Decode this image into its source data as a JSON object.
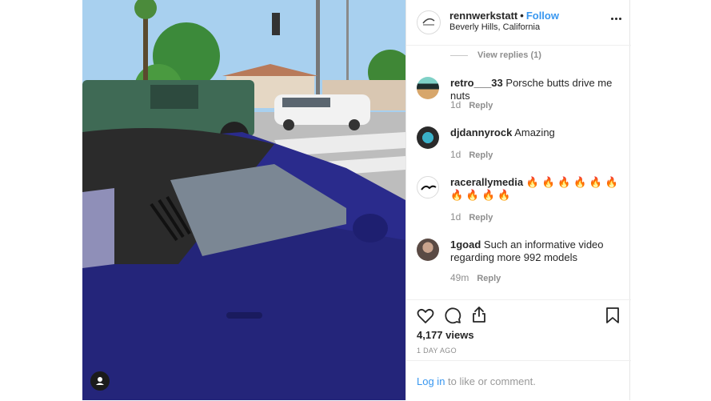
{
  "post": {
    "username": "rennwerkstatt",
    "separator": "•",
    "follow_label": "Follow",
    "location": "Beverly Hills, California"
  },
  "thread": {
    "view_replies": "View replies (1)"
  },
  "comments": [
    {
      "user": "retro___33",
      "text": "Porsche butts drive me nuts",
      "time": "1d",
      "reply": "Reply"
    },
    {
      "user": "djdannyrock",
      "text": "Amazing",
      "time": "1d",
      "reply": "Reply"
    },
    {
      "user": "racerallymedia",
      "text": "🔥 🔥 🔥 🔥 🔥 🔥 🔥 🔥 🔥 🔥",
      "time": "1d",
      "reply": "Reply"
    },
    {
      "user": "1goad",
      "text": "Such an informative video regarding more 992 models",
      "time": "49m",
      "reply": "Reply"
    }
  ],
  "stats": {
    "views": "4,177 views",
    "date": "1 DAY AGO"
  },
  "login": {
    "link": "Log in",
    "rest": " to like or comment."
  },
  "icons": {
    "like": "heart-icon",
    "comment": "comment-icon",
    "share": "share-icon",
    "save": "bookmark-icon",
    "more": "more-options-icon",
    "user_tag": "user-tag-icon"
  },
  "colors": {
    "link": "#3897f0",
    "text": "#262626",
    "muted": "#8e8e8e",
    "car": "#2c2c8c"
  }
}
